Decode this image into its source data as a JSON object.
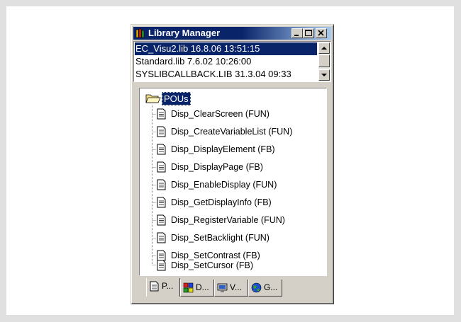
{
  "window": {
    "title": "Library Manager",
    "icons": {
      "app": "library-books-icon",
      "minimize": "minimize-icon",
      "maximize": "maximize-icon",
      "close": "close-icon"
    }
  },
  "libraries": [
    {
      "label": "EC_Visu2.lib 16.8.06 13:51:15",
      "selected": true
    },
    {
      "label": "Standard.lib 7.6.02 10:26:00",
      "selected": false
    },
    {
      "label": "SYSLIBCALLBACK.LIB 31.3.04 09:33",
      "selected": false
    }
  ],
  "tree": {
    "root": {
      "label": "POUs",
      "icon": "open-folder-icon"
    },
    "items": [
      "Disp_ClearScreen (FUN)",
      "Disp_CreateVariableList (FUN)",
      "Disp_DisplayElement (FB)",
      "Disp_DisplayPage (FB)",
      "Disp_EnableDisplay (FUN)",
      "Disp_GetDisplayInfo (FB)",
      "Disp_RegisterVariable (FUN)",
      "Disp_SetBacklight (FUN)",
      "Disp_SetContrast (FB)",
      "Disp_SetCursor (FB)"
    ]
  },
  "tabs": [
    {
      "label": "P...",
      "icon": "document-icon",
      "active": true
    },
    {
      "label": "D...",
      "icon": "data-types-icon",
      "active": false
    },
    {
      "label": "V...",
      "icon": "visualization-icon",
      "active": false
    },
    {
      "label": "G...",
      "icon": "globe-icon",
      "active": false
    }
  ],
  "colors": {
    "selection": "#0a246a",
    "face": "#d4d0c8",
    "background": "#e0e0e0"
  }
}
